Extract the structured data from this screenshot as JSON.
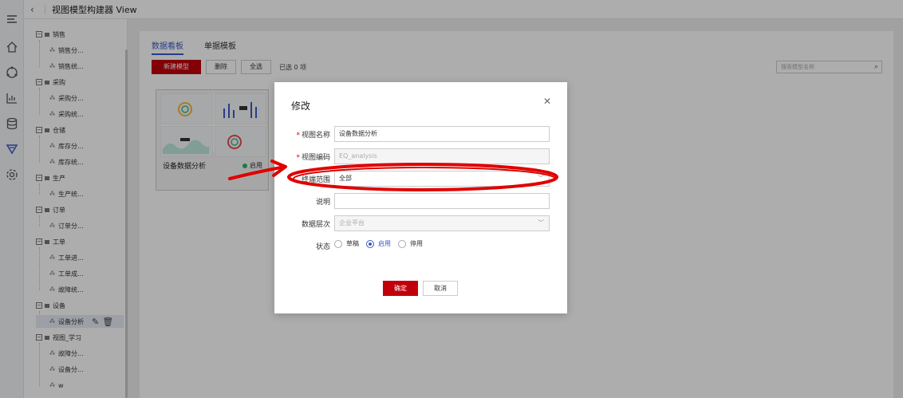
{
  "header": {
    "title": "视图模型构建器 View"
  },
  "tree": [
    {
      "label": "销售",
      "children": [
        "销售分...",
        "销售统..."
      ]
    },
    {
      "label": "采购",
      "children": [
        "采购分...",
        "采购统..."
      ]
    },
    {
      "label": "仓储",
      "children": [
        "库存分...",
        "库存统..."
      ]
    },
    {
      "label": "生产",
      "children": [
        "生产统..."
      ]
    },
    {
      "label": "订单",
      "children": [
        "订单分..."
      ]
    },
    {
      "label": "工单",
      "children": [
        "工单进...",
        "工单成...",
        "故障统..."
      ]
    },
    {
      "label": "设备",
      "children": [
        "设备分析"
      ]
    },
    {
      "label": "视图_学习",
      "children": [
        "故障分...",
        "设备分...",
        "w"
      ]
    }
  ],
  "tabs": [
    "数据看板",
    "单据模板"
  ],
  "toolbar": {
    "new": "新建模型",
    "delete": "删除",
    "select_all": "全选",
    "selected": "已选 0 项"
  },
  "search": {
    "placeholder": "搜索模型名称"
  },
  "card": {
    "title": "设备数据分析",
    "status": "启用"
  },
  "dialog": {
    "title": "修改",
    "fields": {
      "name_label": "视图名称",
      "name_value": "设备数据分析",
      "code_label": "视图编码",
      "code_value": "EQ_analysis",
      "range_label": "终端范围",
      "range_value": "全部",
      "desc_label": "说明",
      "desc_value": "",
      "level_label": "数据层次",
      "level_value": "企业平台",
      "status_label": "状态"
    },
    "status_options": [
      "草稿",
      "启用",
      "停用"
    ],
    "status_selected": "启用",
    "ok": "确定",
    "cancel": "取消"
  },
  "colors": {
    "primary": "#c0000a",
    "accent": "#3a5bc7",
    "annotation": "#e00000"
  }
}
